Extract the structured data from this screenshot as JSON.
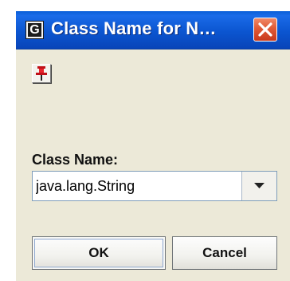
{
  "window": {
    "title": "Class Name for N…",
    "app_icon_letter": "G",
    "app_icon": "app-icon",
    "close_icon": "close-icon"
  },
  "toolbar": {
    "pin_icon": "pin-icon"
  },
  "form": {
    "class_name_label": "Class Name:",
    "class_name_value": "java.lang.String",
    "dropdown_icon": "chevron-down-icon"
  },
  "buttons": {
    "ok_label": "OK",
    "cancel_label": "Cancel"
  },
  "colors": {
    "titlebar": "#0b55d0",
    "dialog_background": "#ece9d8",
    "close_button": "#e05a36",
    "pin_red": "#e8242c"
  }
}
